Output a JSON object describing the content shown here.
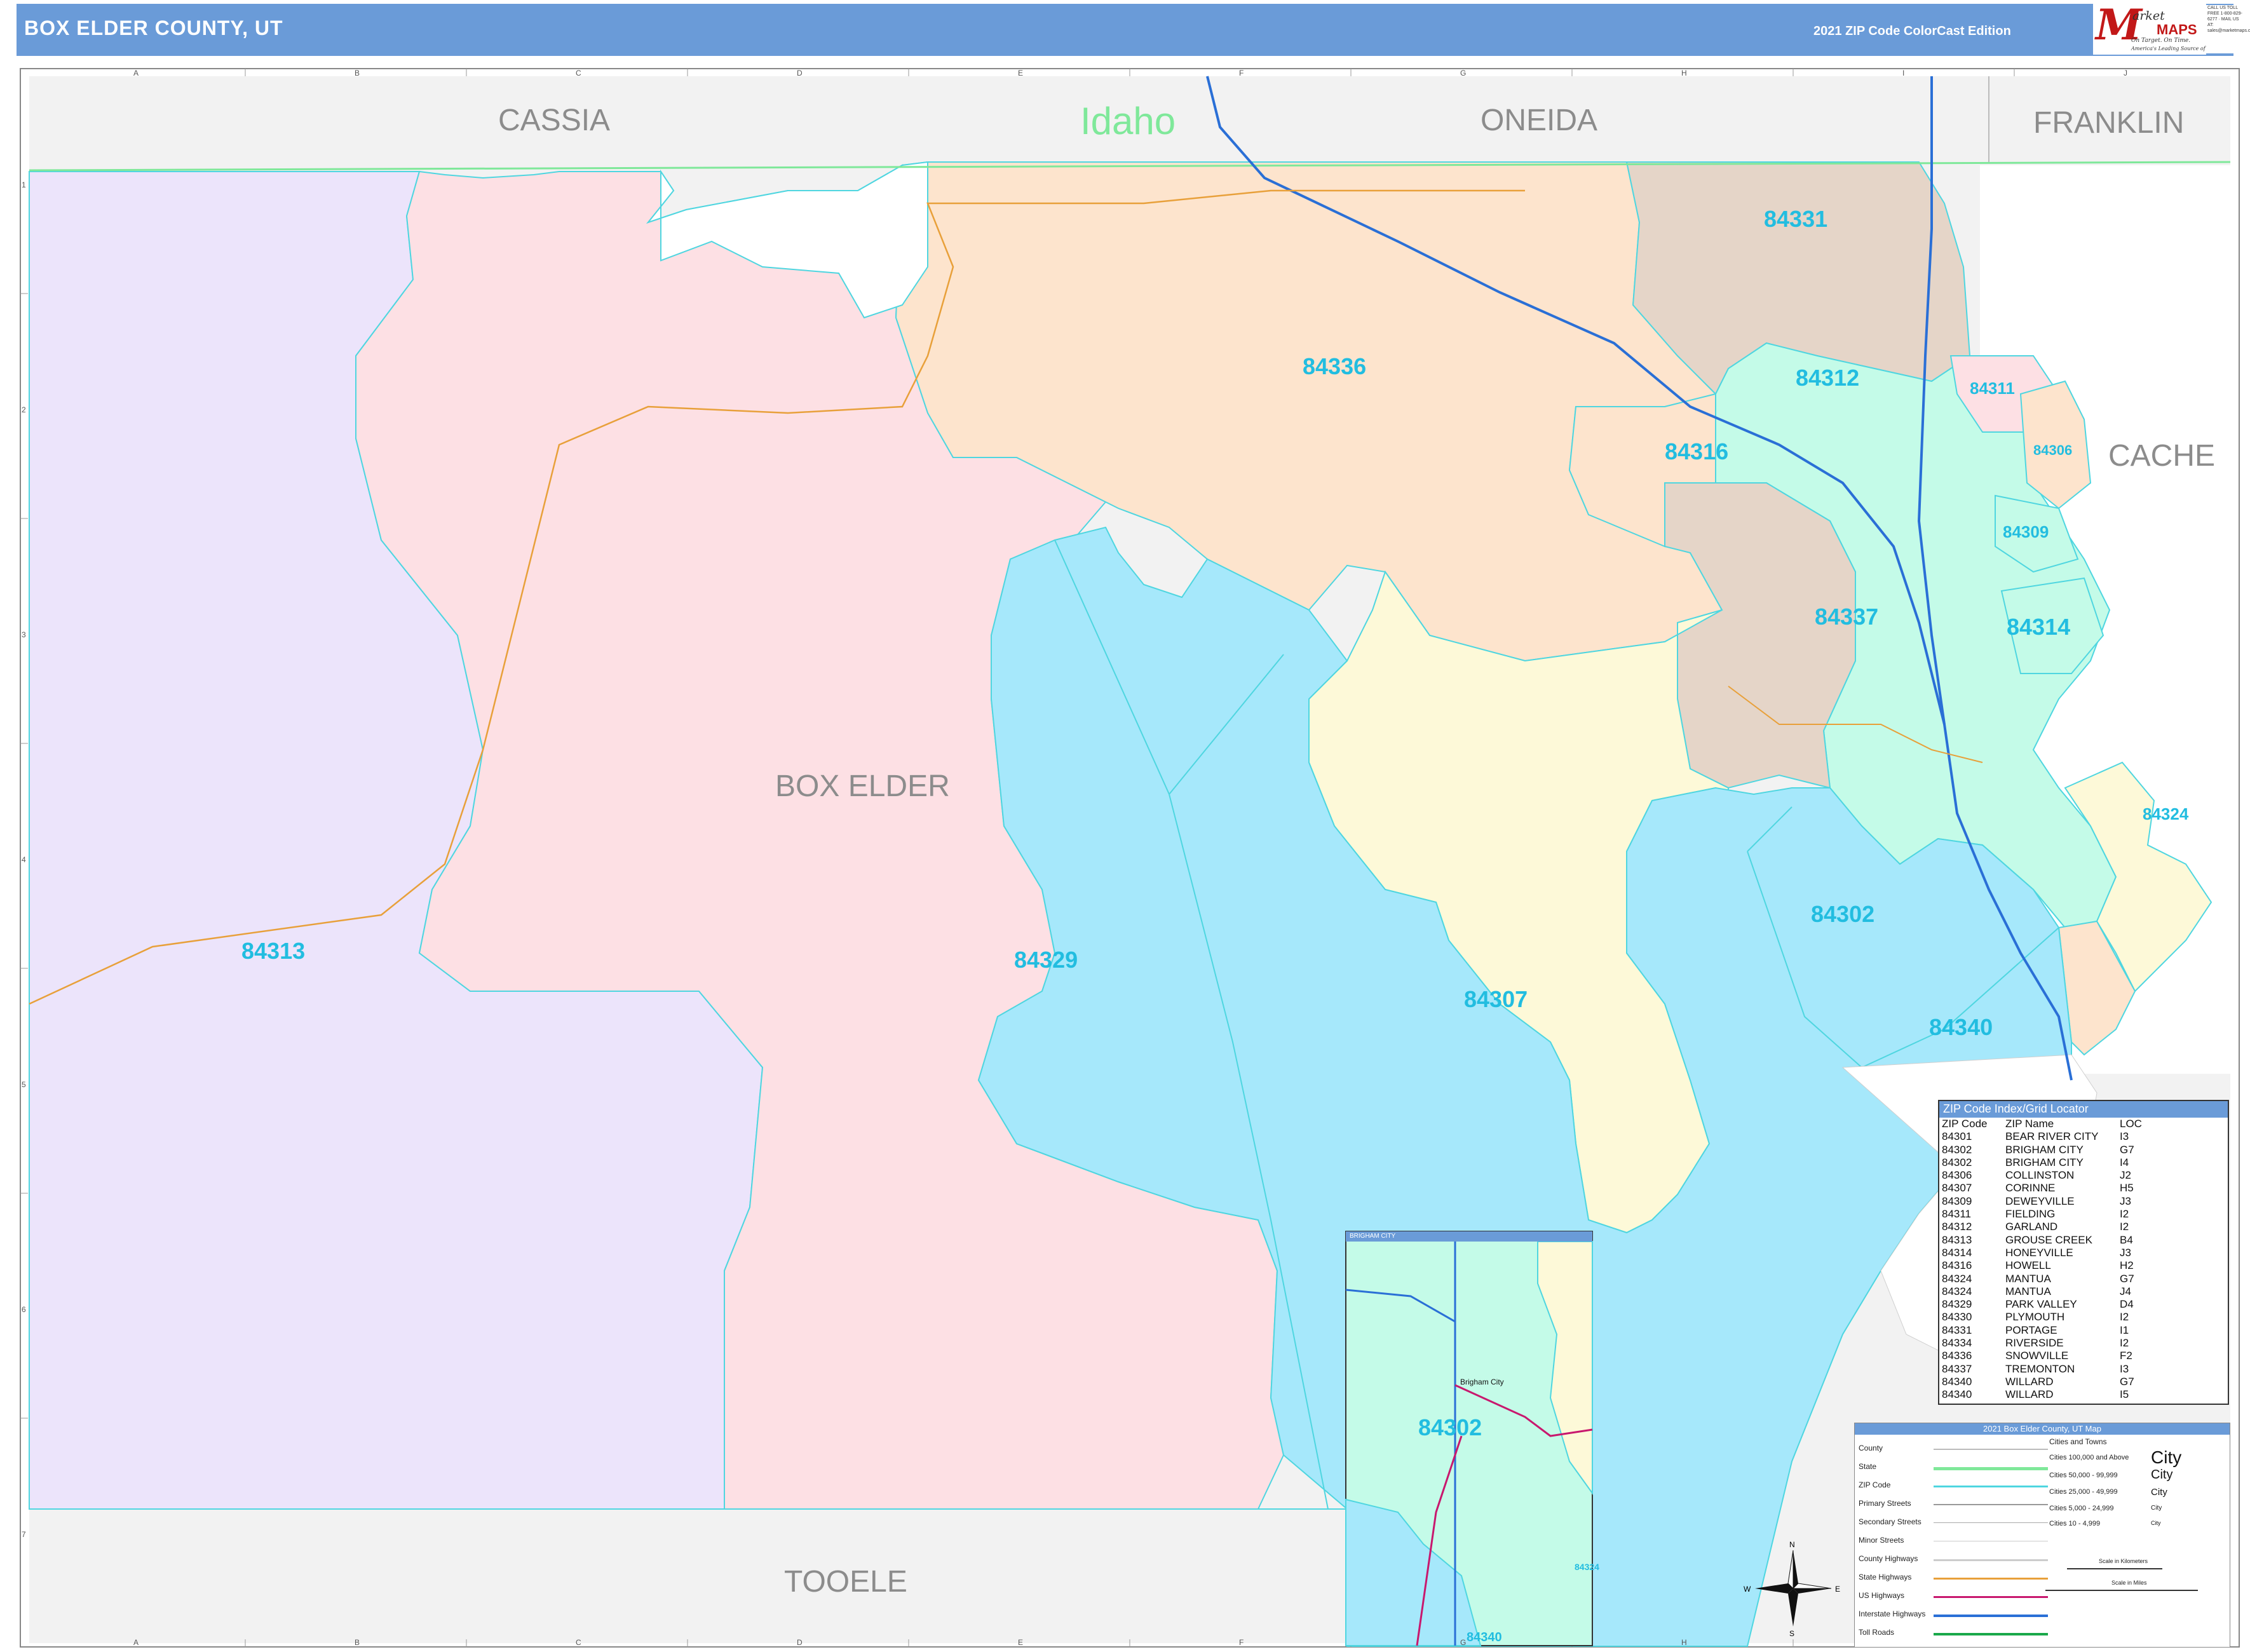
{
  "header": {
    "title": "BOX ELDER COUNTY, UT",
    "edition": "2021 ZIP Code ColorCast Edition",
    "logo_letter": "M",
    "logo_word1": "arket",
    "logo_word2": "MAPS",
    "logo_tagline": "On Target. On Time.",
    "logo_subtag": "America's Leading Source of Business Maps",
    "contact": "CALL US TOLL FREE 1-800-829-6277 · MAIL US AT: sales@marketmaps.com"
  },
  "counties": {
    "cassia": "CASSIA",
    "idaho": "Idaho",
    "oneida": "ONEIDA",
    "franklin": "FRANKLIN",
    "cache": "CACHE",
    "box_elder": "BOX ELDER",
    "tooele": "TOOELE"
  },
  "zip_labels": {
    "z84331": "84331",
    "z84336": "84336",
    "z84312": "84312",
    "z84311": "84311",
    "z84316": "84316",
    "z84306": "84306",
    "z84309": "84309",
    "z84337": "84337",
    "z84314": "84314",
    "z84324": "84324",
    "z84302": "84302",
    "z84340": "84340",
    "z84307": "84307",
    "z84313": "84313",
    "z84329": "84329"
  },
  "grid_letters": [
    "A",
    "B",
    "C",
    "D",
    "E",
    "F",
    "G",
    "H",
    "I",
    "J"
  ],
  "grid_numbers": [
    "1",
    "2",
    "3",
    "4",
    "5",
    "6",
    "7"
  ],
  "zip_index": {
    "title": "ZIP Code Index/Grid Locator",
    "columns": [
      "ZIP Code",
      "ZIP Name",
      "LOC"
    ],
    "rows": [
      [
        "84301",
        "BEAR RIVER CITY",
        "I3"
      ],
      [
        "84302",
        "BRIGHAM CITY",
        "G7"
      ],
      [
        "84302",
        "BRIGHAM CITY",
        "I4"
      ],
      [
        "84306",
        "COLLINSTON",
        "J2"
      ],
      [
        "84307",
        "CORINNE",
        "H5"
      ],
      [
        "84309",
        "DEWEYVILLE",
        "J3"
      ],
      [
        "84311",
        "FIELDING",
        "I2"
      ],
      [
        "84312",
        "GARLAND",
        "I2"
      ],
      [
        "84313",
        "GROUSE CREEK",
        "B4"
      ],
      [
        "84314",
        "HONEYVILLE",
        "J3"
      ],
      [
        "84316",
        "HOWELL",
        "H2"
      ],
      [
        "84324",
        "MANTUA",
        "G7"
      ],
      [
        "84324",
        "MANTUA",
        "J4"
      ],
      [
        "84329",
        "PARK VALLEY",
        "D4"
      ],
      [
        "84330",
        "PLYMOUTH",
        "I2"
      ],
      [
        "84331",
        "PORTAGE",
        "I1"
      ],
      [
        "84334",
        "RIVERSIDE",
        "I2"
      ],
      [
        "84336",
        "SNOWVILLE",
        "F2"
      ],
      [
        "84337",
        "TREMONTON",
        "I3"
      ],
      [
        "84340",
        "WILLARD",
        "G7"
      ],
      [
        "84340",
        "WILLARD",
        "I5"
      ]
    ]
  },
  "legend": {
    "title": "2021 Box Elder County, UT Map",
    "items": [
      "County",
      "State",
      "ZIP Code",
      "Primary Streets",
      "Secondary Streets",
      "Minor Streets",
      "County Highways",
      "State Highways",
      "US Highways",
      "Interstate Highways",
      "Toll Roads"
    ],
    "cities_header": "Cities and Towns",
    "cities": [
      "Cities 100,000 and Above",
      "Cities 50,000 - 99,999",
      "Cities 25,000 - 49,999",
      "Cities 5,000 - 24,999",
      "Cities 10 - 4,999"
    ],
    "city_samples": [
      "City",
      "City",
      "City",
      "City",
      "City"
    ],
    "scale_km": "Scale in Kilometers",
    "scale_mi": "Scale in Miles"
  },
  "compass": {
    "n": "N",
    "s": "S",
    "e": "E",
    "w": "W"
  },
  "inset": {
    "title": "BRIGHAM CITY",
    "zip_main": "84302",
    "zip_324": "84324",
    "zip_340": "84340",
    "city": "Brigham City"
  },
  "colors": {
    "header_bar": "#6a9bd8",
    "lake": "#a6e8fb",
    "zip_label": "#22bde0",
    "z84313": "#ece4fb",
    "z84329": "#fde0e4",
    "z84336": "#fde4cd",
    "z84307": "#fdf9d8",
    "z84331": "#e5d5c8",
    "z84312": "#c4fbe8",
    "outside": "#f2f2f2"
  }
}
